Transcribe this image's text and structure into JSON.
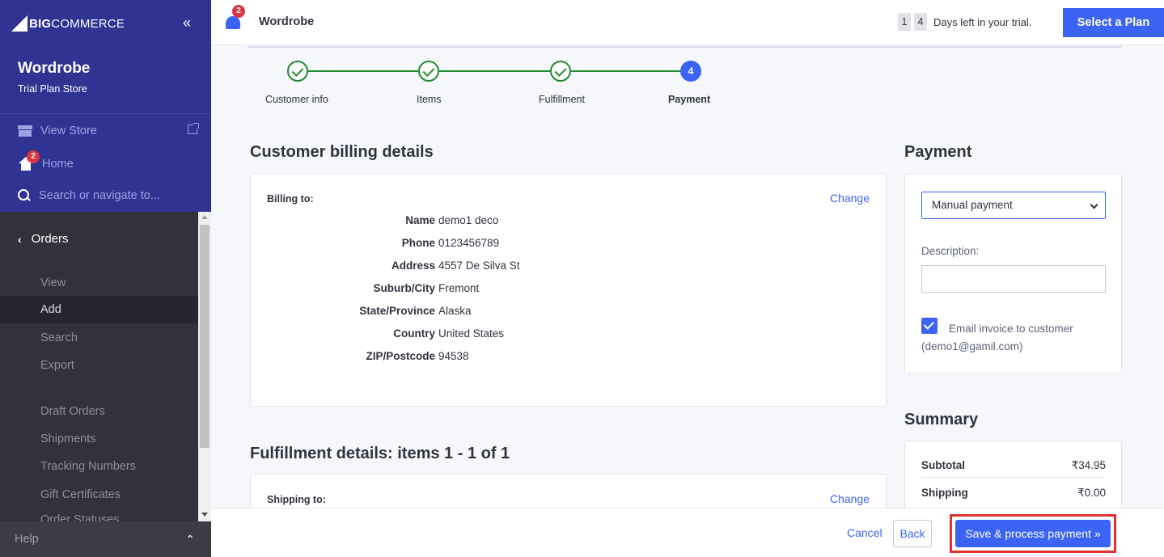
{
  "sidebar": {
    "logo_text_big": "BIG",
    "logo_text_rest": "COMMERCE",
    "collapse_icon": "double-chevron-left-icon",
    "store_name": "Wordrobe",
    "store_plan": "Trial Plan Store",
    "view_store_label": "View Store",
    "home_label": "Home",
    "home_badge": "2",
    "search_placeholder": "Search or navigate to...",
    "section_label": "Orders",
    "items": [
      {
        "label": "View",
        "active": false
      },
      {
        "label": "Add",
        "active": true
      },
      {
        "label": "Search",
        "active": false
      },
      {
        "label": "Export",
        "active": false
      },
      {
        "label": "Draft Orders",
        "active": false
      },
      {
        "label": "Shipments",
        "active": false
      },
      {
        "label": "Tracking Numbers",
        "active": false
      },
      {
        "label": "Gift Certificates",
        "active": false
      },
      {
        "label": "Order Statuses",
        "active": false
      }
    ],
    "help_label": "Help"
  },
  "header": {
    "notification_badge": "2",
    "store_title": "Wordrobe",
    "trial_digits": [
      "1",
      "4"
    ],
    "trial_text": "Days left in your trial.",
    "select_plan_label": "Select a Plan"
  },
  "stepper": {
    "steps": [
      {
        "label": "Customer info",
        "state": "done"
      },
      {
        "label": "Items",
        "state": "done"
      },
      {
        "label": "Fulfillment",
        "state": "done"
      },
      {
        "label": "Payment",
        "state": "current",
        "number": "4"
      }
    ]
  },
  "billing": {
    "title": "Customer billing details",
    "label": "Billing to:",
    "change_label": "Change",
    "fields": [
      {
        "key": "Name",
        "value": "demo1 deco"
      },
      {
        "key": "Phone",
        "value": "0123456789"
      },
      {
        "key": "Address",
        "value": "4557 De Silva St"
      },
      {
        "key": "Suburb/City",
        "value": "Fremont"
      },
      {
        "key": "State/Province",
        "value": "Alaska"
      },
      {
        "key": "Country",
        "value": "United States"
      },
      {
        "key": "ZIP/Postcode",
        "value": "94538"
      }
    ]
  },
  "fulfillment": {
    "title": "Fulfillment details: items 1 - 1 of 1",
    "label": "Shipping to:",
    "change_label": "Change"
  },
  "payment": {
    "title": "Payment",
    "method_selected": "Manual payment",
    "description_label": "Description:",
    "description_value": "",
    "email_checked": true,
    "email_label": "Email invoice to customer (demo1@gamil.com)"
  },
  "summary": {
    "title": "Summary",
    "rows": [
      {
        "label": "Subtotal",
        "value": "₹34.95"
      },
      {
        "label": "Shipping",
        "value": "₹0.00"
      }
    ]
  },
  "footer": {
    "cancel_label": "Cancel",
    "back_label": "Back",
    "save_label": "Save & process payment »"
  },
  "colors": {
    "sidebar_top": "#313393",
    "sidebar_bg": "#33323c",
    "accent": "#3c64f4",
    "success": "#208831",
    "badge": "#db3643",
    "highlight_outline": "#e0312f"
  }
}
